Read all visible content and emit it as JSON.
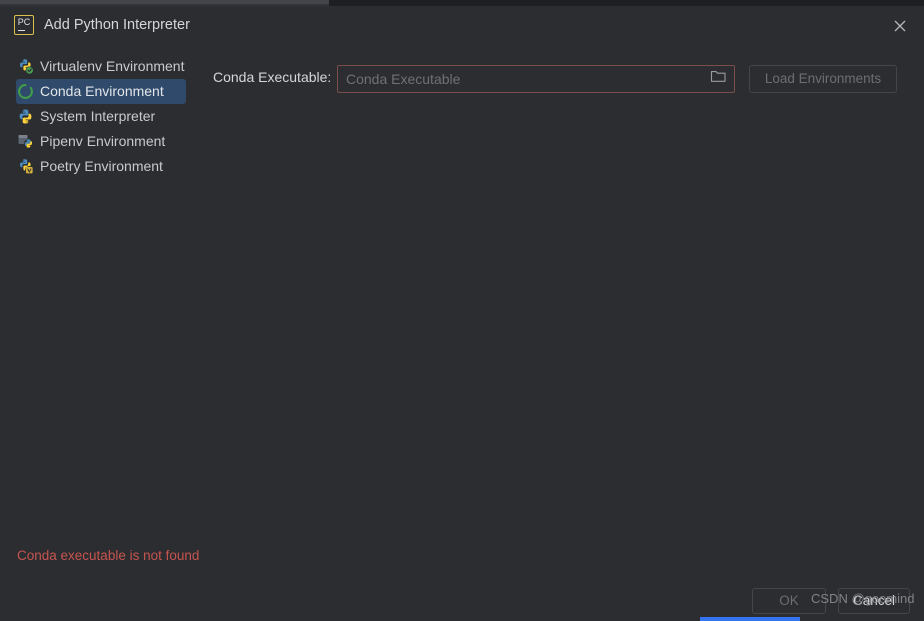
{
  "window": {
    "title": "Add Python Interpreter",
    "app_icon_name": "pycharm-icon",
    "app_icon_text": "PC",
    "close_icon": "close-icon"
  },
  "sidebar": {
    "items": [
      {
        "label": "Virtualenv Environment",
        "icon": "python-virtualenv-icon",
        "selected": false
      },
      {
        "label": "Conda Environment",
        "icon": "conda-ring-icon",
        "selected": true
      },
      {
        "label": "System Interpreter",
        "icon": "python-icon",
        "selected": false
      },
      {
        "label": "Pipenv Environment",
        "icon": "pipenv-icon",
        "selected": false
      },
      {
        "label": "Poetry Environment",
        "icon": "poetry-icon",
        "selected": false
      }
    ]
  },
  "form": {
    "conda_executable_label": "Conda Executable:",
    "conda_executable_value": "",
    "conda_executable_placeholder": "Conda Executable",
    "browse_icon": "folder-icon",
    "load_environments_label": "Load Environments",
    "load_environments_enabled": false
  },
  "status": {
    "error_message": "Conda executable is not found"
  },
  "footer": {
    "ok_label": "OK",
    "ok_enabled": false,
    "cancel_label": "Cancel"
  },
  "overlay": {
    "watermark": "CSDN @goomind"
  },
  "colors": {
    "dialog_background": "#2b2d30",
    "selection_blue": "#2f4a6b",
    "error_red": "#c75450",
    "error_border": "#7b4f49",
    "accent_blue": "#3574f0",
    "text_primary": "#d4d6da",
    "text_disabled": "#6b6e73"
  }
}
